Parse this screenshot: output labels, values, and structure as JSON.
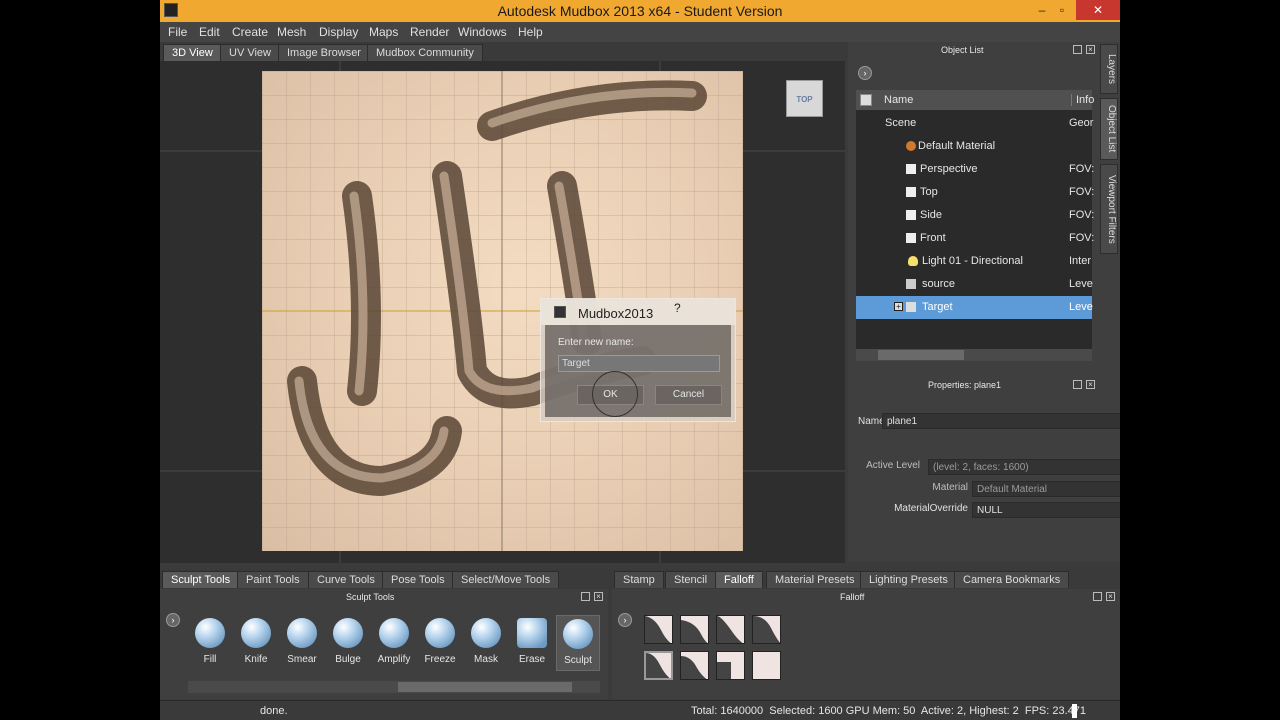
{
  "window": {
    "title": "Autodesk Mudbox 2013 x64 - Student Version",
    "minimize": "–",
    "restore": "▫",
    "close": "✕"
  },
  "menu": [
    "File",
    "Edit",
    "Create",
    "Mesh",
    "Display",
    "Maps",
    "Render",
    "Windows",
    "Help"
  ],
  "view_tabs": [
    "3D View",
    "UV View",
    "Image Browser",
    "Mudbox Community"
  ],
  "viewcube": {
    "label": "TOP"
  },
  "dialog": {
    "title": "Mudbox2013",
    "help": "?",
    "prompt": "Enter new name:",
    "value": "Target",
    "ok": "OK",
    "cancel": "Cancel"
  },
  "side_tabs": [
    "Layers",
    "Object List",
    "Viewport Filters"
  ],
  "object_list": {
    "title": "Object List",
    "columns": {
      "name": "Name",
      "info": "Info"
    },
    "rows": [
      {
        "name": "Scene",
        "info": "Geor",
        "icon": "scene-icon"
      },
      {
        "name": "Default Material",
        "info": "",
        "icon": "material-icon"
      },
      {
        "name": "Perspective",
        "info": "FOV:",
        "icon": "camera-icon"
      },
      {
        "name": "Top",
        "info": "FOV:",
        "icon": "camera-icon"
      },
      {
        "name": "Side",
        "info": "FOV:",
        "icon": "camera-icon"
      },
      {
        "name": "Front",
        "info": "FOV:",
        "icon": "camera-icon"
      },
      {
        "name": "Light 01 - Directional",
        "info": "Inter",
        "icon": "light-icon"
      },
      {
        "name": "source",
        "info": "Leve",
        "icon": "mesh-icon"
      },
      {
        "name": "Target",
        "info": "Leve",
        "icon": "mesh-icon",
        "selected": true
      }
    ]
  },
  "properties": {
    "title": "Properties: plane1",
    "name_label": "Name",
    "name_value": "plane1",
    "active_level_label": "Active Level",
    "active_level_value": "(level: 2, faces: 1600)",
    "material_label": "Material",
    "material_value": "Default Material",
    "override_label": "MaterialOverride",
    "override_value": "NULL"
  },
  "bottom_tabs_left": [
    "Sculpt Tools",
    "Paint Tools",
    "Curve Tools",
    "Pose Tools",
    "Select/Move Tools"
  ],
  "bottom_tabs_right": [
    "Stamp",
    "Stencil",
    "Falloff",
    "Material Presets",
    "Lighting Presets",
    "Camera Bookmarks"
  ],
  "sculpt_tray": {
    "title": "Sculpt Tools",
    "tools": [
      "Fill",
      "Knife",
      "Smear",
      "Bulge",
      "Amplify",
      "Freeze",
      "Mask",
      "Erase",
      "Sculpt"
    ],
    "active": "Sculpt"
  },
  "falloff_tray": {
    "title": "Falloff"
  },
  "status": {
    "message": "done.",
    "stats": "Total: 1640000  Selected: 1600 GPU Mem: 50  Active: 2, Highest: 2  FPS: 23.471"
  }
}
